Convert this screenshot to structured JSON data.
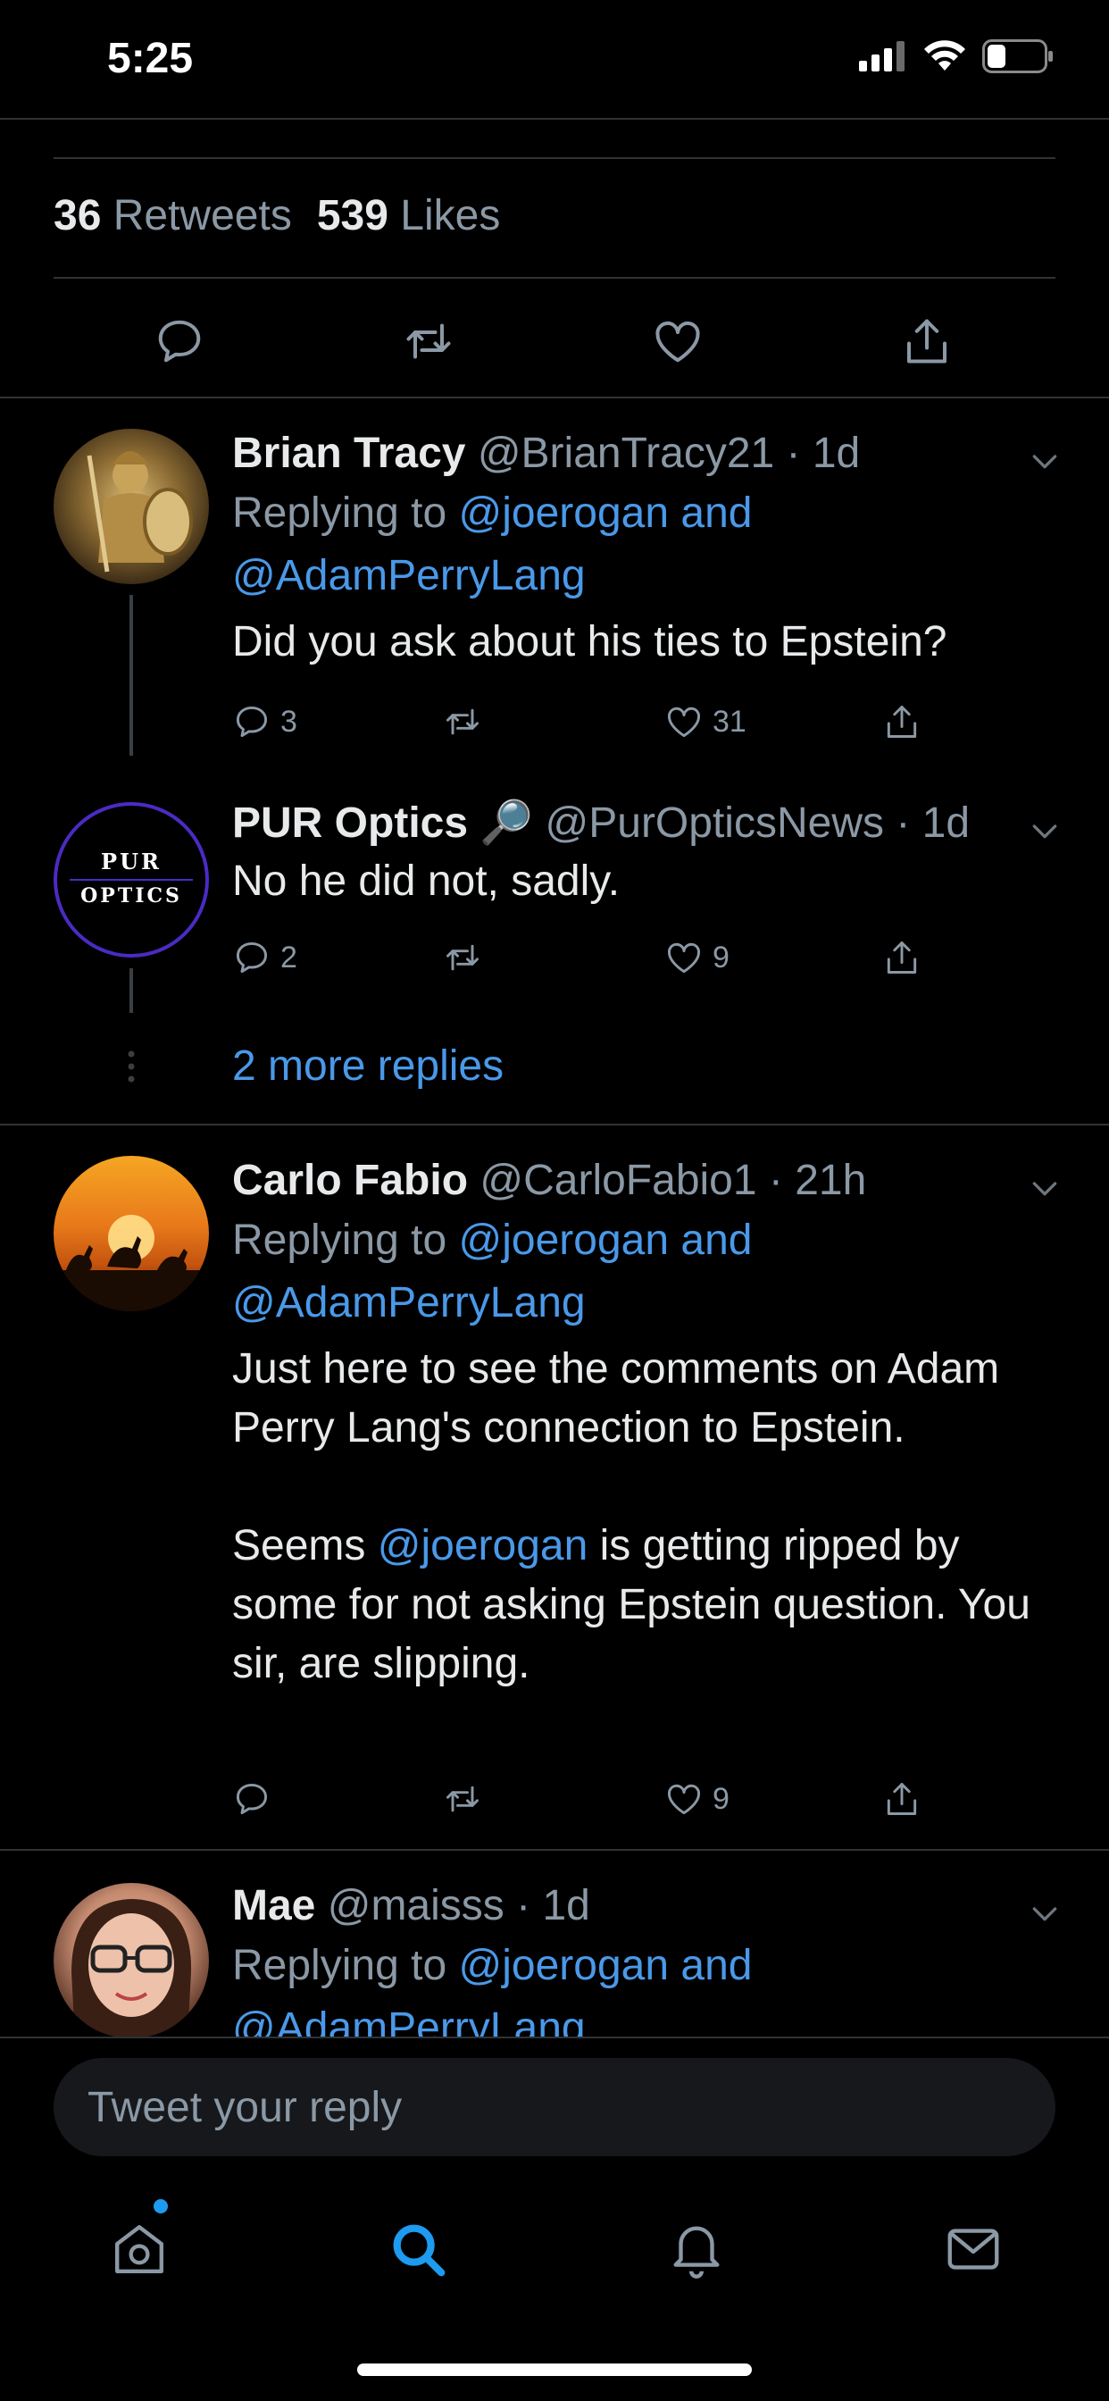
{
  "status_bar": {
    "time": "5:25"
  },
  "stats": {
    "retweets_count": "36",
    "retweets_label": "Retweets",
    "likes_count": "539",
    "likes_label": "Likes"
  },
  "tweets": [
    {
      "name": "Brian Tracy",
      "handle": "@BrianTracy21",
      "time": "1d",
      "replying_prefix": "Replying to",
      "replying_line1": "@joerogan and",
      "replying_line2": "@AdamPerryLang",
      "text": "Did you ask about his ties to Epstein?",
      "reply_count": "3",
      "retweet_count": "",
      "like_count": "31"
    },
    {
      "name": "PUR Optics",
      "emoji": "🔎",
      "handle": "@PurOpticsNews",
      "time": "1d",
      "avatar_text_top": "PUR",
      "avatar_text_bottom": "OPTICS",
      "text": "No he did not, sadly.",
      "reply_count": "2",
      "retweet_count": "",
      "like_count": "9"
    },
    {
      "name": "Carlo Fabio",
      "handle": "@CarloFabio1",
      "time": "21h",
      "replying_prefix": "Replying to",
      "replying_line1": "@joerogan and",
      "replying_line2": "@AdamPerryLang",
      "text_p1": "Just here to see the comments on Adam Perry Lang's connection to Epstein.",
      "text_p2_a": "Seems ",
      "text_p2_mention": "@joerogan",
      "text_p2_b": " is getting ripped by some for not asking Epstein question. You sir, are slipping.",
      "reply_count": "",
      "retweet_count": "",
      "like_count": "9"
    },
    {
      "name": "Mae",
      "handle": "@maisss",
      "time": "1d",
      "replying_prefix": "Replying to",
      "replying_line1": "@joerogan and",
      "replying_line2": "@AdamPerryLang"
    }
  ],
  "more_replies": "2 more replies",
  "reply_bar": {
    "placeholder": "Tweet your reply"
  },
  "tabs": [
    "home-icon",
    "search-icon",
    "notifications-icon",
    "messages-icon"
  ],
  "colors": {
    "accent": "#1d9bf0",
    "link": "#4a99e9",
    "muted": "#8b98a5",
    "background": "#000000"
  }
}
